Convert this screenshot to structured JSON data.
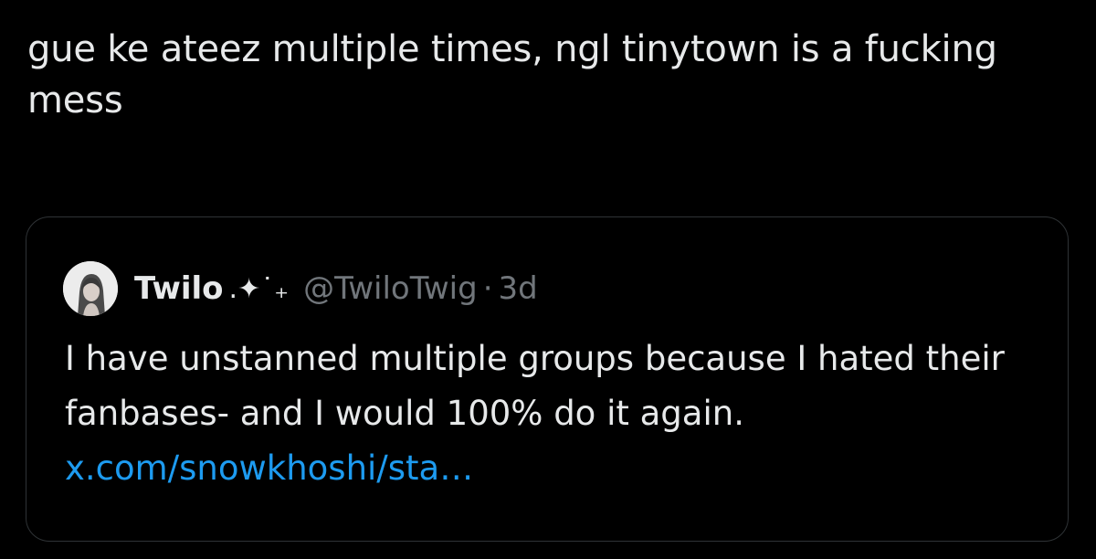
{
  "tweet": {
    "text": "gue ke ateez multiple times, ngl tinytown is a fucking mess"
  },
  "quote": {
    "avatar_icon": "profile-photo-avatar",
    "display_name": "Twilo",
    "name_decoration": ".✦˙₊",
    "handle": "@TwiloTwig",
    "separator": "·",
    "time": "3d",
    "body_text": "I have unstanned multiple groups because I hated their fanbases- and I would 100% do it again.",
    "link_text": "x.com/snowkhoshi/sta…"
  },
  "colors": {
    "background": "#000000",
    "text_primary": "#e7e9ea",
    "text_secondary": "#71767b",
    "link": "#1d9bf0",
    "border": "#2f3336"
  }
}
